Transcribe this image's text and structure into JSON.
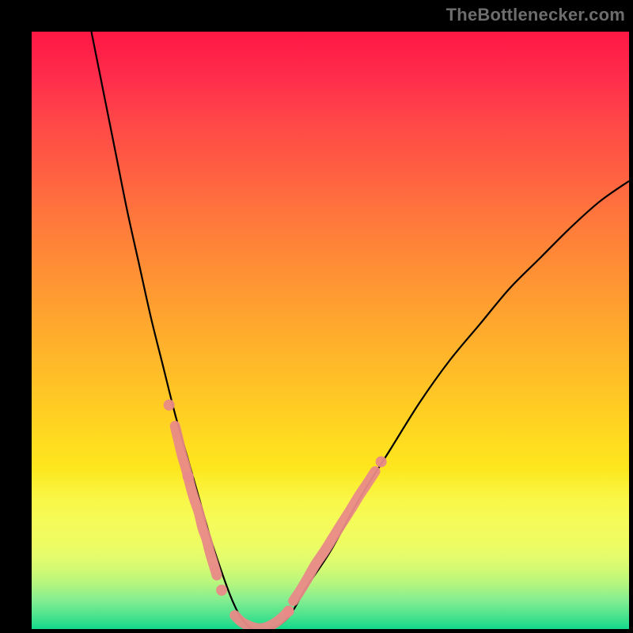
{
  "credit_text": "TheBottlenecker.com",
  "chart_data": {
    "type": "line",
    "title": "",
    "xlabel": "",
    "ylabel": "",
    "xlim": [
      0,
      100
    ],
    "ylim": [
      0,
      100
    ],
    "curve": {
      "x": [
        10,
        12,
        14,
        16,
        18,
        20,
        22,
        24,
        26,
        28,
        30,
        32,
        33.5,
        35,
        37,
        40,
        43,
        46,
        50,
        55,
        60,
        65,
        70,
        75,
        80,
        85,
        90,
        95,
        100
      ],
      "y": [
        100,
        90,
        80,
        70,
        61,
        52,
        44,
        36,
        29,
        22,
        15,
        9,
        5,
        2,
        0,
        0,
        2,
        7,
        13,
        22,
        30,
        38,
        45,
        51,
        57,
        62,
        67,
        71.5,
        75
      ]
    },
    "salmon_segments": [
      {
        "x": [
          24.0,
          24.6,
          25.2,
          25.8,
          26.7,
          27.3,
          28.0,
          28.6,
          29.3,
          29.8,
          30.4,
          31.0
        ],
        "y": [
          34.0,
          31.5,
          29.0,
          27.0,
          23.5,
          21.5,
          19.5,
          17.0,
          15.0,
          13.0,
          11.0,
          9.0
        ]
      },
      {
        "x": [
          34.0,
          35.0,
          36.0,
          37.0,
          38.0,
          39.0,
          40.0,
          41.0,
          42.0,
          43.0
        ],
        "y": [
          2.3,
          1.3,
          0.7,
          0.3,
          0.1,
          0.2,
          0.6,
          1.2,
          2.0,
          3.0
        ]
      },
      {
        "x": [
          43.8,
          45.0,
          46.2,
          47.5,
          49.0,
          50.5,
          52.0,
          53.4,
          54.8,
          56.2,
          57.5
        ],
        "y": [
          4.7,
          6.5,
          8.5,
          10.8,
          13.0,
          15.4,
          17.8,
          20.0,
          22.3,
          24.4,
          26.4
        ]
      }
    ],
    "salmon_dots": [
      {
        "x": 23.0,
        "y": 37.5
      },
      {
        "x": 26.2,
        "y": 25.5
      },
      {
        "x": 31.8,
        "y": 6.5
      },
      {
        "x": 43.0,
        "y": 3.0
      },
      {
        "x": 58.5,
        "y": 28.0
      }
    ],
    "colors": {
      "curve": "#000000",
      "salmon": "#e98a88"
    }
  }
}
